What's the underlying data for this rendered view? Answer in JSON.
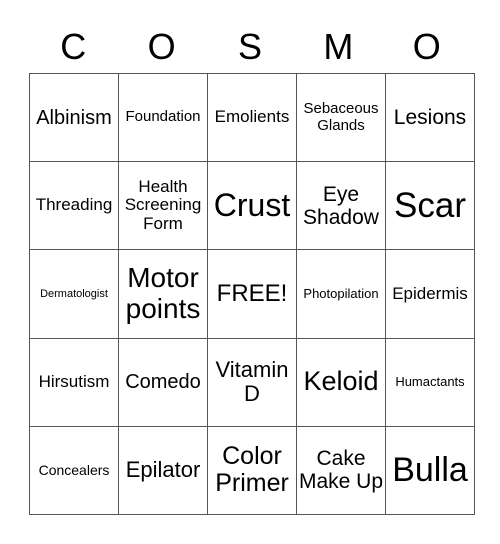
{
  "title_letters": [
    "C",
    "O",
    "S",
    "M",
    "O"
  ],
  "cells": [
    [
      {
        "text": "Albinism",
        "size": 20
      },
      {
        "text": "Foundation",
        "size": 15
      },
      {
        "text": "Emolients",
        "size": 17
      },
      {
        "text": "Sebaceous Glands",
        "size": 15
      },
      {
        "text": "Lesions",
        "size": 21
      }
    ],
    [
      {
        "text": "Threading",
        "size": 17
      },
      {
        "text": "Health Screening Form",
        "size": 17
      },
      {
        "text": "Crust",
        "size": 32
      },
      {
        "text": "Eye Shadow",
        "size": 21
      },
      {
        "text": "Scar",
        "size": 35
      }
    ],
    [
      {
        "text": "Dermatologist",
        "size": 11
      },
      {
        "text": "Motor points",
        "size": 28
      },
      {
        "text": "FREE!",
        "size": 24
      },
      {
        "text": "Photopilation",
        "size": 13
      },
      {
        "text": "Epidermis",
        "size": 17
      }
    ],
    [
      {
        "text": "Hirsutism",
        "size": 17
      },
      {
        "text": "Comedo",
        "size": 20
      },
      {
        "text": "Vitamin D",
        "size": 22
      },
      {
        "text": "Keloid",
        "size": 27
      },
      {
        "text": "Humactants",
        "size": 13
      }
    ],
    [
      {
        "text": "Concealers",
        "size": 14
      },
      {
        "text": "Epilator",
        "size": 22
      },
      {
        "text": "Color Primer",
        "size": 25
      },
      {
        "text": "Cake Make Up",
        "size": 21
      },
      {
        "text": "Bulla",
        "size": 34
      }
    ]
  ]
}
